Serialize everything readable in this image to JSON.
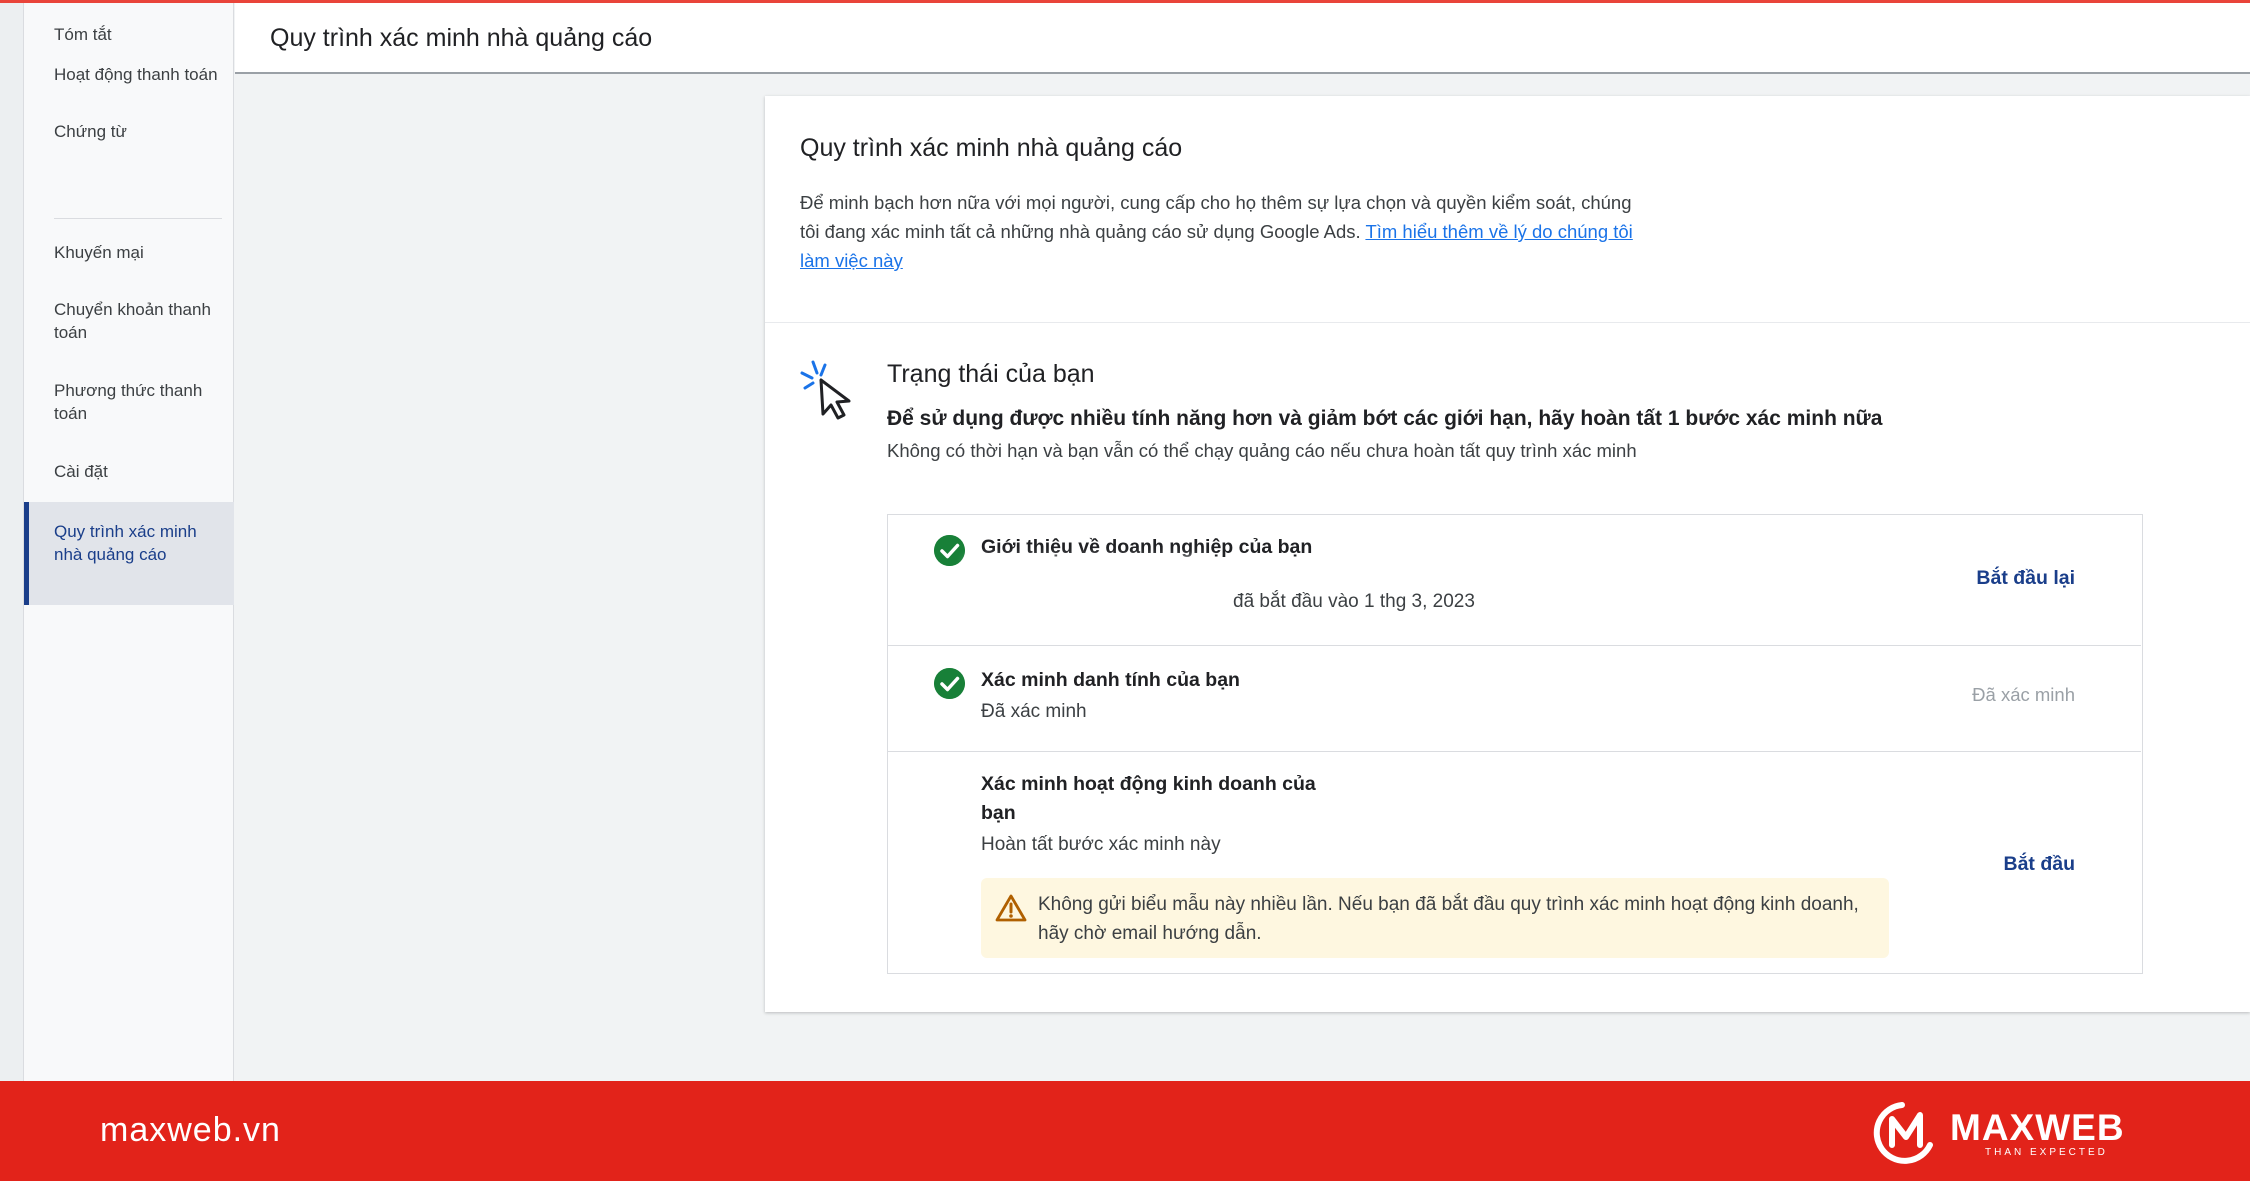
{
  "sidebar": {
    "items": [
      {
        "label": "Tóm tắt"
      },
      {
        "label": "Hoạt động thanh toán"
      },
      {
        "label": "Chứng từ"
      },
      {
        "label": "Khuyến mại"
      },
      {
        "label": "Chuyển khoản thanh toán"
      },
      {
        "label": "Phương thức thanh toán"
      },
      {
        "label": "Cài đặt"
      },
      {
        "label": "Quy trình xác minh nhà quảng cáo",
        "active": true
      }
    ]
  },
  "header": {
    "title": "Quy trình xác minh nhà quảng cáo"
  },
  "card": {
    "title": "Quy trình xác minh nhà quảng cáo",
    "description": "Để minh bạch hơn nữa với mọi người, cung cấp cho họ thêm sự lựa chọn và quyền kiểm soát, chúng tôi đang xác minh tất cả những nhà quảng cáo sử dụng Google Ads. ",
    "learn_more_link": "Tìm hiểu thêm về lý do chúng tôi làm việc này"
  },
  "status": {
    "title": "Trạng thái của bạn",
    "lead": "Để sử dụng được nhiều tính năng hơn và giảm bớt các giới hạn, hãy hoàn tất 1 bước xác minh nữa",
    "sub": "Không có thời hạn và bạn vẫn có thể chạy quảng cáo nếu chưa hoàn tất quy trình xác minh"
  },
  "steps": [
    {
      "title": "Giới thiệu về doanh nghiệp của bạn",
      "subtitle": "đã bắt đầu vào 1 thg 3, 2023",
      "action": "Bắt đầu lại",
      "completed": true
    },
    {
      "title": "Xác minh danh tính của bạn",
      "subtitle": "Đã xác minh",
      "action": "Đã xác minh",
      "completed": true
    },
    {
      "title": "Xác minh hoạt động kinh doanh của bạn",
      "subtitle": "Hoàn tất bước xác minh này",
      "action": "Bắt đầu",
      "completed": false,
      "warning": "Không gửi biểu mẫu này nhiều lần. Nếu bạn đã bắt đầu quy trình xác minh hoạt động kinh doanh, hãy chờ email hướng dẫn."
    }
  ],
  "footer": {
    "site": "maxweb.vn",
    "brand": "MAXWEB",
    "tagline": "THAN EXPECTED"
  },
  "colors": {
    "accent": "#1a3e8a",
    "link": "#1a73e8",
    "success": "#188038",
    "warning_bg": "#fef7e0",
    "footer_red": "#e2231a"
  },
  "icons": {
    "status": "cursor-click-icon",
    "check": "check-circle-icon",
    "warning": "warning-triangle-icon"
  }
}
